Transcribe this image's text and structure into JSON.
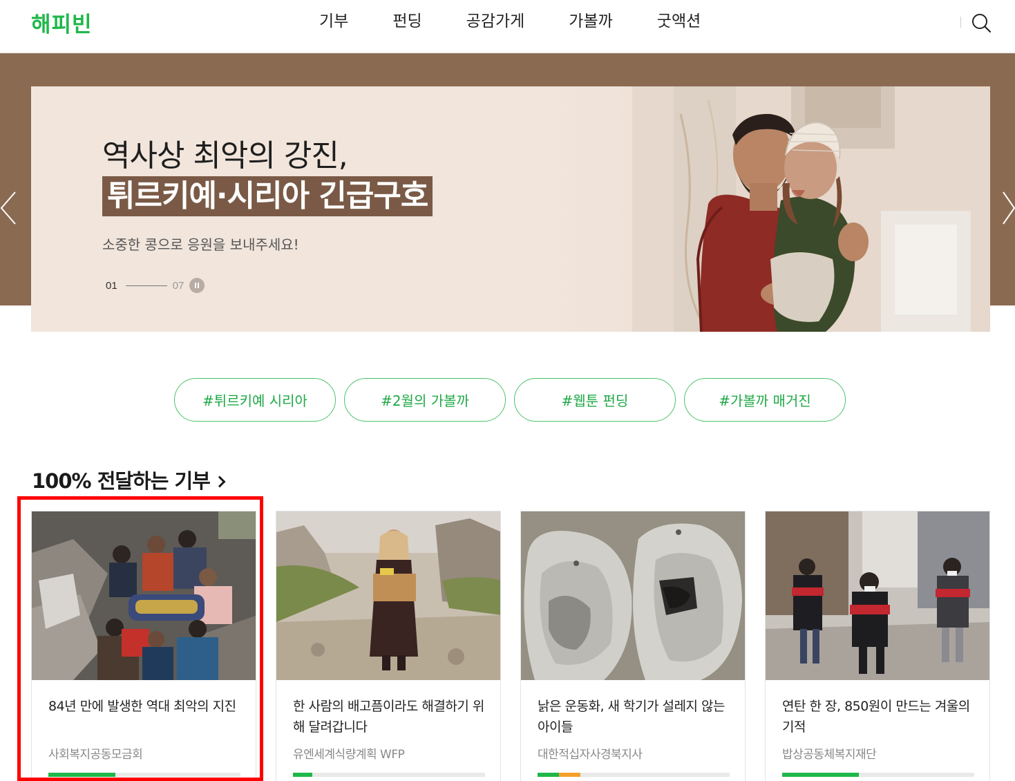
{
  "header": {
    "logo": "해피빈",
    "nav": [
      "기부",
      "펀딩",
      "공감가게",
      "가볼까",
      "굿액션"
    ],
    "search_icon": "search-icon"
  },
  "hero": {
    "title_line1": "역사상 최악의 강진,",
    "title_line2": "튀르키예·시리아 긴급구호",
    "subtitle": "소중한 콩으로 응원을 보내주세요!",
    "pager_current": "01",
    "pager_total": "07",
    "band_color": "#8b6a52",
    "highlight_color": "#7a5a46"
  },
  "tags": [
    "#튀르키예 시리아",
    "#2월의 가볼까",
    "#웹툰 펀딩",
    "#가볼까 매거진"
  ],
  "section": {
    "title": "100% 전달하는 기부"
  },
  "cards": [
    {
      "title": "84년 만에 발생한 역대 최악의 지진",
      "org": "사회복지공동모금회",
      "progress": 0.35
    },
    {
      "title": "한 사람의 배고픔이라도 해결하기 위해 달려갑니다",
      "org": "유엔세계식량계획 WFP",
      "progress": 0.1
    },
    {
      "title": "낡은 운동화, 새 학기가 설레지 않는 아이들",
      "org": "대한적십자사경북지사",
      "progress": 0.11,
      "progress_secondary": 0.11
    },
    {
      "title": "연탄 한 장, 850원이 만드는 겨울의 기적",
      "org": "밥상공동체복지재단",
      "progress": 0.4
    }
  ],
  "colors": {
    "brand_green": "#1eb84a",
    "tag_border": "#49c46a",
    "progress_orange": "#f5a02c",
    "highlight_red": "#ff0000"
  }
}
